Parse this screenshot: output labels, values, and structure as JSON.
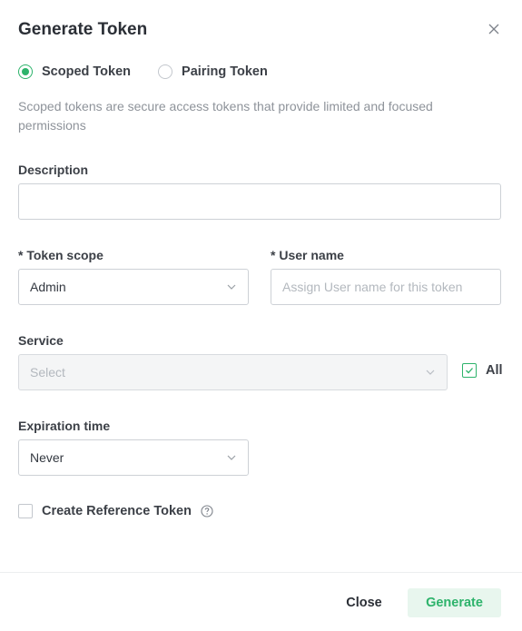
{
  "dialog": {
    "title": "Generate Token",
    "close_icon": "close-x-icon"
  },
  "token_type": {
    "options": [
      {
        "label": "Scoped Token",
        "checked": true
      },
      {
        "label": "Pairing Token",
        "checked": false
      }
    ],
    "description": "Scoped tokens are secure access tokens that provide limited and focused permissions"
  },
  "form": {
    "description_label": "Description",
    "description_value": "",
    "token_scope_label": "* Token scope",
    "token_scope_value": "Admin",
    "user_name_label": "* User name",
    "user_name_placeholder": "Assign User name for this token",
    "service_label": "Service",
    "service_placeholder": "Select",
    "all_label": "All",
    "all_checked": true,
    "expiration_label": "Expiration time",
    "expiration_value": "Never",
    "reference_label": "Create Reference Token",
    "reference_checked": false,
    "help_icon": "question-circle-icon",
    "chevron_icon": "chevron-down-icon"
  },
  "footer": {
    "close_label": "Close",
    "generate_label": "Generate"
  },
  "colors": {
    "accent": "#2db36b",
    "accent_bg": "#e8f6ee",
    "border": "#cdd1d6",
    "muted_text": "#8e939a"
  }
}
